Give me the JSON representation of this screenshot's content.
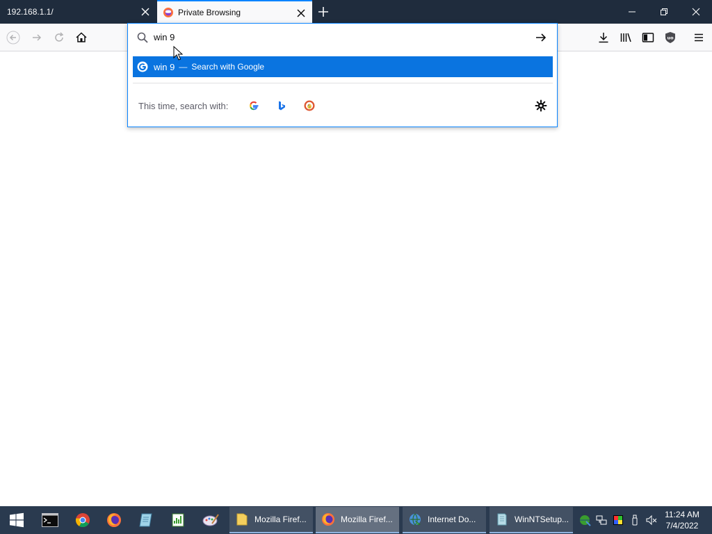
{
  "tabs": [
    {
      "title": "192.168.1.1/",
      "active": false
    },
    {
      "title": "Private Browsing",
      "active": true
    }
  ],
  "urlbar": {
    "value": "win 9",
    "result": {
      "query": "win 9",
      "separator": "—",
      "action": "Search with Google"
    },
    "oneoff_label": "This time, search with:",
    "engines": [
      "google-icon",
      "bing-icon",
      "duckduckgo-icon"
    ]
  },
  "taskbar": {
    "apps": [
      {
        "label": "Mozilla Firef...",
        "icon": "folder-icon",
        "active": false
      },
      {
        "label": "Mozilla Firef...",
        "icon": "firefox-icon",
        "active": true
      },
      {
        "label": "Internet Do...",
        "icon": "internet-download-manager-icon",
        "active": false
      },
      {
        "label": "WinNTSetup...",
        "icon": "winntsetup-icon",
        "active": false
      }
    ],
    "clock": {
      "time": "11:24 AM",
      "date": "7/4/2022"
    }
  },
  "colors": {
    "accent": "#0a84ff",
    "selected_row": "#0a74e0",
    "tabbar": "#1f2c3d",
    "taskbar": "#2a3a4f"
  }
}
